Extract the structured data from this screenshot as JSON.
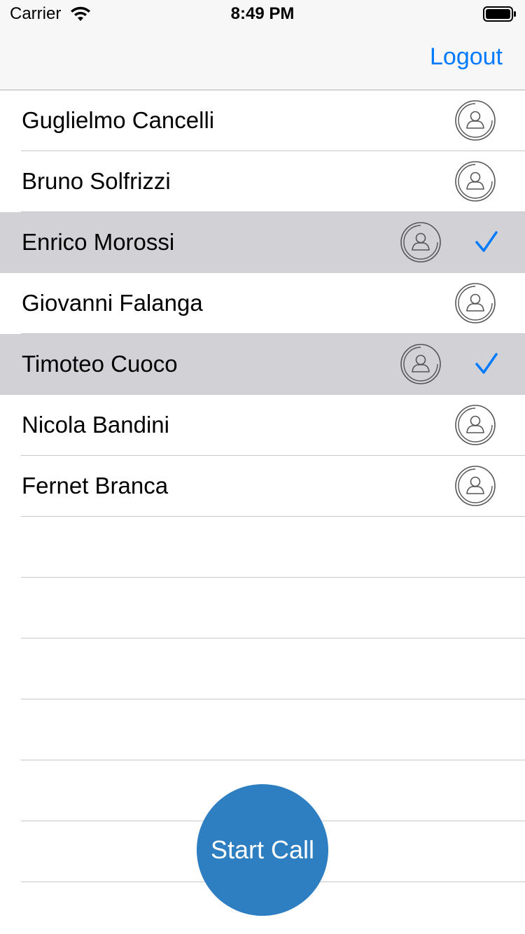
{
  "status_bar": {
    "carrier": "Carrier",
    "time": "8:49 PM"
  },
  "nav": {
    "logout_label": "Logout"
  },
  "contacts": [
    {
      "name": "Guglielmo Cancelli",
      "selected": false
    },
    {
      "name": "Bruno Solfrizzi",
      "selected": false
    },
    {
      "name": "Enrico Morossi",
      "selected": true
    },
    {
      "name": "Giovanni Falanga",
      "selected": false
    },
    {
      "name": "Timoteo Cuoco",
      "selected": true
    },
    {
      "name": "Nicola Bandini",
      "selected": false
    },
    {
      "name": "Fernet Branca",
      "selected": false
    }
  ],
  "empty_rows": 6,
  "start_call_label": "Start Call",
  "colors": {
    "accent": "#007aff",
    "button": "#2e7ec2",
    "selected_row": "#d1d1d6"
  }
}
